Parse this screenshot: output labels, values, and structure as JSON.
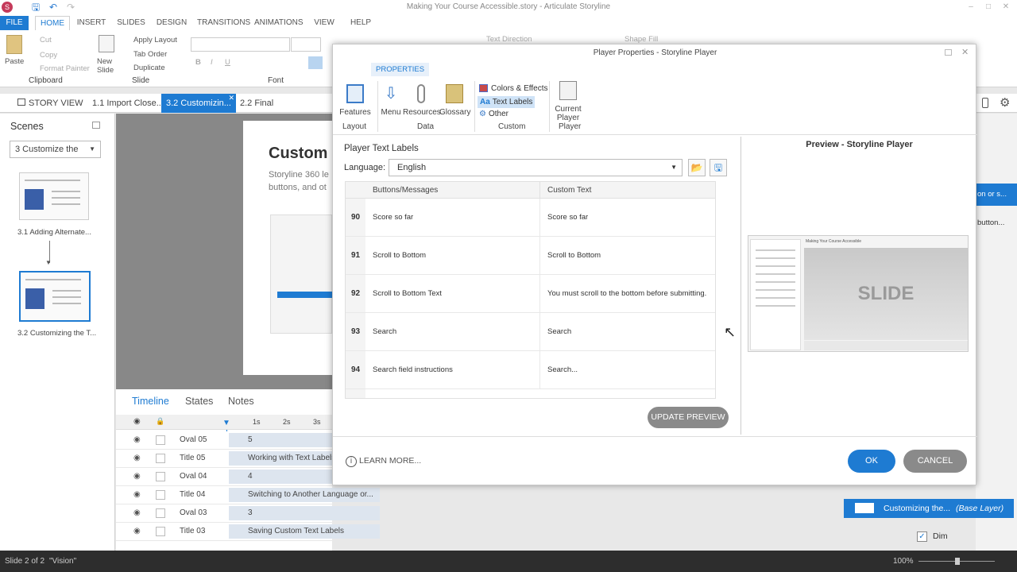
{
  "window": {
    "title": "Making Your Course Accessible.story - Articulate Storyline"
  },
  "ribbon": {
    "tabs": [
      "FILE",
      "HOME",
      "INSERT",
      "SLIDES",
      "DESIGN",
      "TRANSITIONS",
      "ANIMATIONS",
      "VIEW",
      "HELP"
    ],
    "clipboard": {
      "paste": "Paste",
      "cut": "Cut",
      "copy": "Copy",
      "format_painter": "Format Painter",
      "group": "Clipboard"
    },
    "slide": {
      "new_slide": "New Slide",
      "apply_layout": "Apply Layout",
      "tab_order": "Tab Order",
      "duplicate": "Duplicate",
      "group": "Slide"
    },
    "font": {
      "group": "Font"
    },
    "paragraph": {
      "text_direction": "Text Direction",
      "shape_fill": "Shape Fill"
    }
  },
  "story_tabs": [
    "STORY VIEW",
    "1.1 Import Close...",
    "3.2 Customizin...",
    "2.2 Final"
  ],
  "scenes": {
    "title": "Scenes",
    "select": "3 Customize the",
    "slides": [
      {
        "label": "3.1 Adding Alternate..."
      },
      {
        "label": "3.2 Customizing the T..."
      }
    ]
  },
  "canvas": {
    "slide_heading": "Custom",
    "slide_body_1": "Storyline 360 le",
    "slide_body_2": "buttons, and ot"
  },
  "timeline": {
    "tabs": [
      "Timeline",
      "States",
      "Notes"
    ],
    "ticks": [
      "1s",
      "2s",
      "3s"
    ],
    "rows": [
      {
        "name": "Oval 05",
        "bar": "5"
      },
      {
        "name": "Title 05",
        "bar": "Working with Text Labels"
      },
      {
        "name": "Oval 04",
        "bar": "4"
      },
      {
        "name": "Title 04",
        "bar": "Switching to Another Language or..."
      },
      {
        "name": "Oval 03",
        "bar": "3"
      },
      {
        "name": "Title 03",
        "bar": "Saving Custom Text Labels"
      }
    ]
  },
  "right_panel": {
    "base_layer": "Customizing the...",
    "base_layer_tag": "(Base Layer)",
    "dim": "Dim",
    "snippet_1": "on or s...",
    "snippet_2": "button..."
  },
  "status": {
    "slide": "Slide 2 of 2",
    "theme": "\"Vision\"",
    "zoom": "100%"
  },
  "dialog": {
    "title": "Player Properties - Storyline Player",
    "properties_tab": "PROPERTIES",
    "groups": {
      "layout": {
        "label": "Layout",
        "buttons": [
          "Features"
        ]
      },
      "data": {
        "label": "Data",
        "buttons": [
          "Menu",
          "Resources",
          "Glossary"
        ]
      },
      "custom": {
        "label": "Custom",
        "buttons": [
          "Colors & Effects",
          "Text Labels",
          "Other"
        ]
      },
      "player": {
        "label": "Player",
        "buttons": [
          "Current Player"
        ]
      }
    },
    "section_title": "Player Text Labels",
    "language_label": "Language:",
    "language_value": "English",
    "columns": [
      "Buttons/Messages",
      "Custom Text"
    ],
    "rows": [
      {
        "num": "90",
        "message": "Score so far",
        "custom": "Score so far"
      },
      {
        "num": "91",
        "message": "Scroll to Bottom",
        "custom": "Scroll to Bottom"
      },
      {
        "num": "92",
        "message": "Scroll to Bottom Text",
        "custom": "You must scroll to the bottom before submitting."
      },
      {
        "num": "93",
        "message": "Search",
        "custom": "Search"
      },
      {
        "num": "94",
        "message": "Search field instructions",
        "custom": "Search..."
      }
    ],
    "update_preview": "UPDATE PREVIEW",
    "preview_title": "Preview - Storyline Player",
    "preview_slide_text": "SLIDE",
    "preview_course_title": "Making Your Course Accessible",
    "learn_more": "LEARN MORE...",
    "ok": "OK",
    "cancel": "CANCEL"
  }
}
